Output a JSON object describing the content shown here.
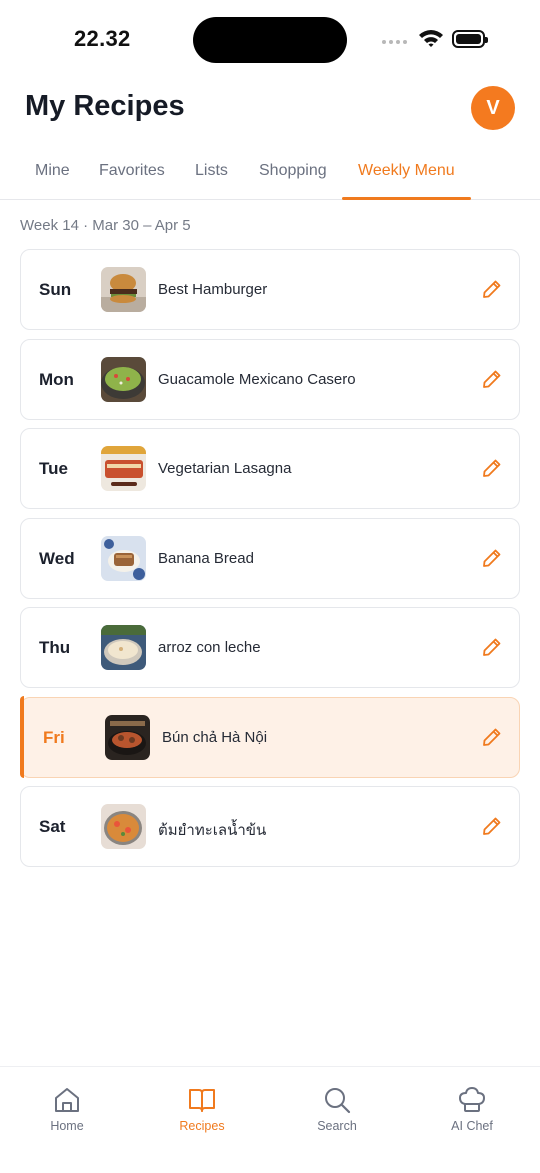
{
  "status_bar": {
    "time": "22.32",
    "icons": [
      "cellular-signal-icon",
      "wifi-icon",
      "battery-icon"
    ]
  },
  "header": {
    "title": "My Recipes",
    "avatar_initial": "V"
  },
  "tabs": [
    {
      "label": "Mine",
      "active": false
    },
    {
      "label": "Favorites",
      "active": false
    },
    {
      "label": "Lists",
      "active": false
    },
    {
      "label": "Shopping",
      "active": false
    },
    {
      "label": "Weekly Menu",
      "active": true
    }
  ],
  "week": {
    "label": "Week 14 · Mar 30 – Apr 5"
  },
  "days": [
    {
      "day": "Sun",
      "recipe": "Best Hamburger",
      "highlighted": false
    },
    {
      "day": "Mon",
      "recipe": "Guacamole Mexicano Casero",
      "highlighted": false
    },
    {
      "day": "Tue",
      "recipe": "Vegetarian Lasagna",
      "highlighted": false
    },
    {
      "day": "Wed",
      "recipe": "Banana Bread",
      "highlighted": false
    },
    {
      "day": "Thu",
      "recipe": "arroz con leche",
      "highlighted": false
    },
    {
      "day": "Fri",
      "recipe": "Bún chả Hà Nội",
      "highlighted": true
    },
    {
      "day": "Sat",
      "recipe": "ต้มยำทะเลน้ำข้น",
      "highlighted": false
    }
  ],
  "bottom_nav": [
    {
      "label": "Home",
      "icon": "home-icon",
      "active": false
    },
    {
      "label": "Recipes",
      "icon": "book-icon",
      "active": true
    },
    {
      "label": "Search",
      "icon": "search-icon",
      "active": false
    },
    {
      "label": "AI Chef",
      "icon": "chef-hat-icon",
      "active": false
    }
  ],
  "colors": {
    "accent": "#f07a1e",
    "highlight_background": "#fef1e7",
    "card_border": "#e5e7eb",
    "muted_text": "#6b7180"
  }
}
